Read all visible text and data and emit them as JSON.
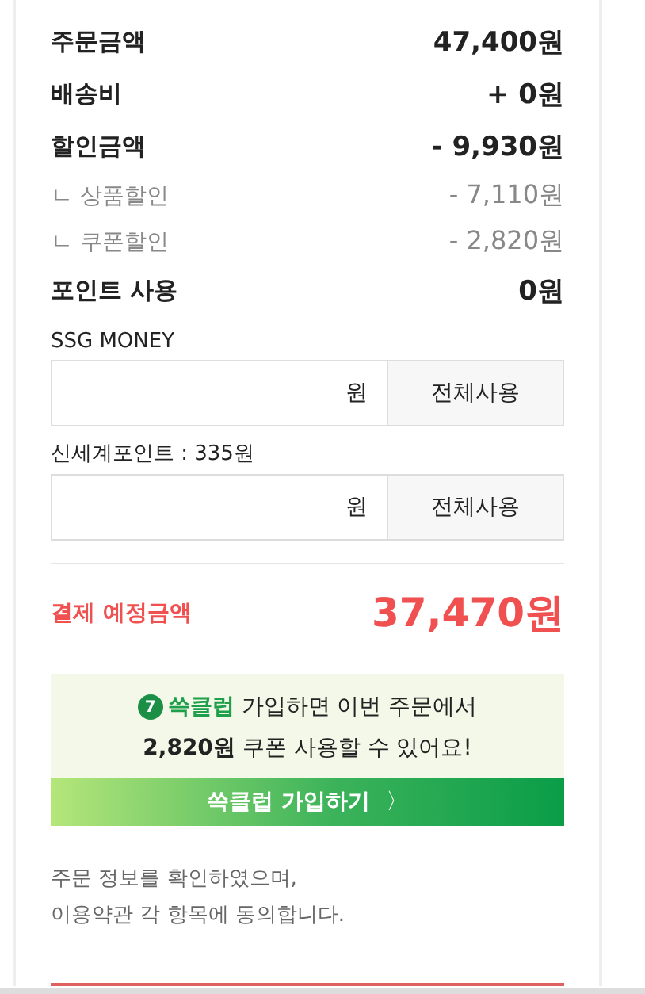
{
  "amounts": [
    {
      "kind": "main",
      "label": "주문금액",
      "value": "47,400원"
    },
    {
      "kind": "main",
      "label": "배송비",
      "value": "+ 0원"
    },
    {
      "kind": "main",
      "label": "할인금액",
      "value": "- 9,930원"
    },
    {
      "kind": "sub",
      "label": "ㄴ 상품할인",
      "value": "- 7,110원"
    },
    {
      "kind": "sub",
      "label": "ㄴ 쿠폰할인",
      "value": "- 2,820원"
    },
    {
      "kind": "main",
      "label": "포인트 사용",
      "value": "0원"
    }
  ],
  "point_fields": [
    {
      "label": "SSG MONEY",
      "unit": "원",
      "button": "전체사용"
    },
    {
      "label": "신세계포인트 : 335원",
      "unit": "원",
      "button": "전체사용"
    }
  ],
  "total": {
    "label": "결제 예정금액",
    "value": "37,470원"
  },
  "club_banner": {
    "badge": "7",
    "line_1": "**쓱클럽** 가입하면 이번 주문에서",
    "line_2": "**2,820원** 쿠폰 사용할 수 있어요!",
    "button": "쓱클럽 가입하기",
    "button_icon": "〉"
  },
  "terms": [
    "주문 정보를 확인하였으며,",
    "이용약관 각 항목에 동의합니다."
  ]
}
